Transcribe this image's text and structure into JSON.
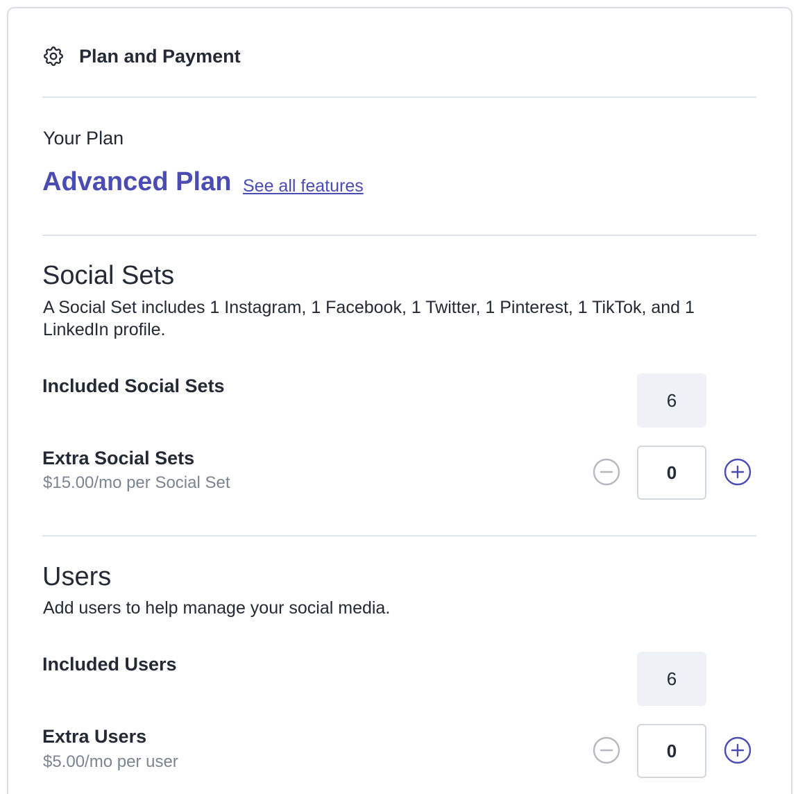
{
  "header": {
    "title": "Plan and Payment",
    "icon": "gear-icon"
  },
  "plan": {
    "label": "Your Plan",
    "name": "Advanced Plan",
    "features_link": "See all features"
  },
  "social_sets": {
    "title": "Social Sets",
    "description": "A Social Set includes 1 Instagram, 1 Facebook, 1 Twitter, 1 Pinterest, 1 TikTok, and 1 LinkedIn profile.",
    "included": {
      "label": "Included Social Sets",
      "value": "6"
    },
    "extra": {
      "label": "Extra Social Sets",
      "price": "$15.00/mo per Social Set",
      "value": "0"
    }
  },
  "users": {
    "title": "Users",
    "description": "Add users to help manage your social media.",
    "included": {
      "label": "Included Users",
      "value": "6"
    },
    "extra": {
      "label": "Extra Users",
      "price": "$5.00/mo per user",
      "value": "0"
    }
  },
  "colors": {
    "accent": "#4b4cb3",
    "muted": "#7b8592",
    "disabled": "#b5b9bf",
    "divider": "#dfe5ec"
  }
}
